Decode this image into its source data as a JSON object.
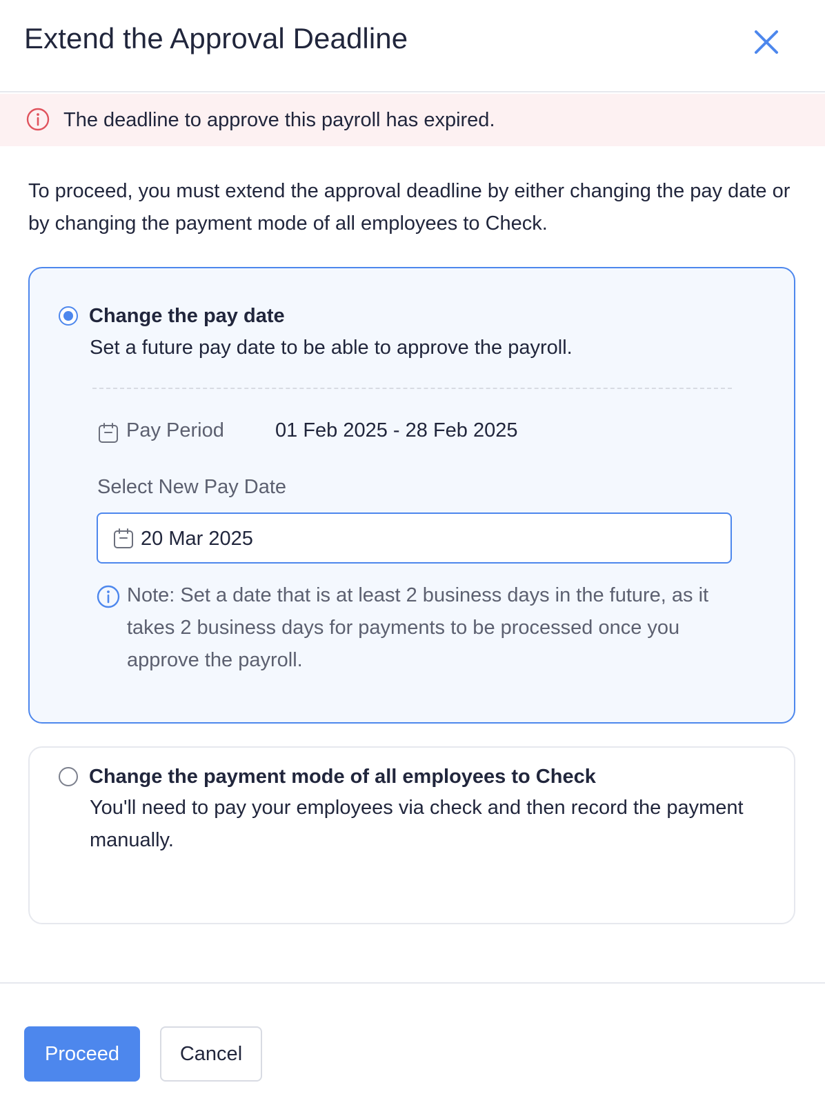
{
  "dialog": {
    "title": "Extend the Approval Deadline",
    "close_icon": "close-icon"
  },
  "alert": {
    "icon": "info-circle-icon",
    "message": "The deadline to approve this payroll has expired.",
    "color": "#e0535d",
    "background": "#fdf1f2"
  },
  "intro": {
    "text": "To proceed, you must extend the approval deadline by either changing the pay date or by changing the payment mode of all employees to Check."
  },
  "options": [
    {
      "label": "Change the pay date",
      "description": "Set a future pay date to be able to approve the payroll.",
      "selected": true,
      "pay_period": {
        "label": "Pay Period",
        "value": "01 Feb 2025 - 28 Feb 2025"
      },
      "new_pay_date": {
        "label": "Select New Pay Date",
        "value": "20 Mar 2025"
      },
      "note": "Note: Set a date that is at least 2 business days in the future, as it takes 2 business days for payments to be processed once you approve the payroll."
    },
    {
      "label": "Change the payment mode of all employees to Check",
      "description": "You'll need to pay your employees via check and then record the payment manually.",
      "selected": false
    }
  ],
  "footer": {
    "proceed_label": "Proceed",
    "cancel_label": "Cancel"
  },
  "colors": {
    "accent": "#4d87ed",
    "selected_card_bg": "#f4f8fe",
    "text_primary": "#21263c",
    "text_secondary": "#5c6070"
  }
}
